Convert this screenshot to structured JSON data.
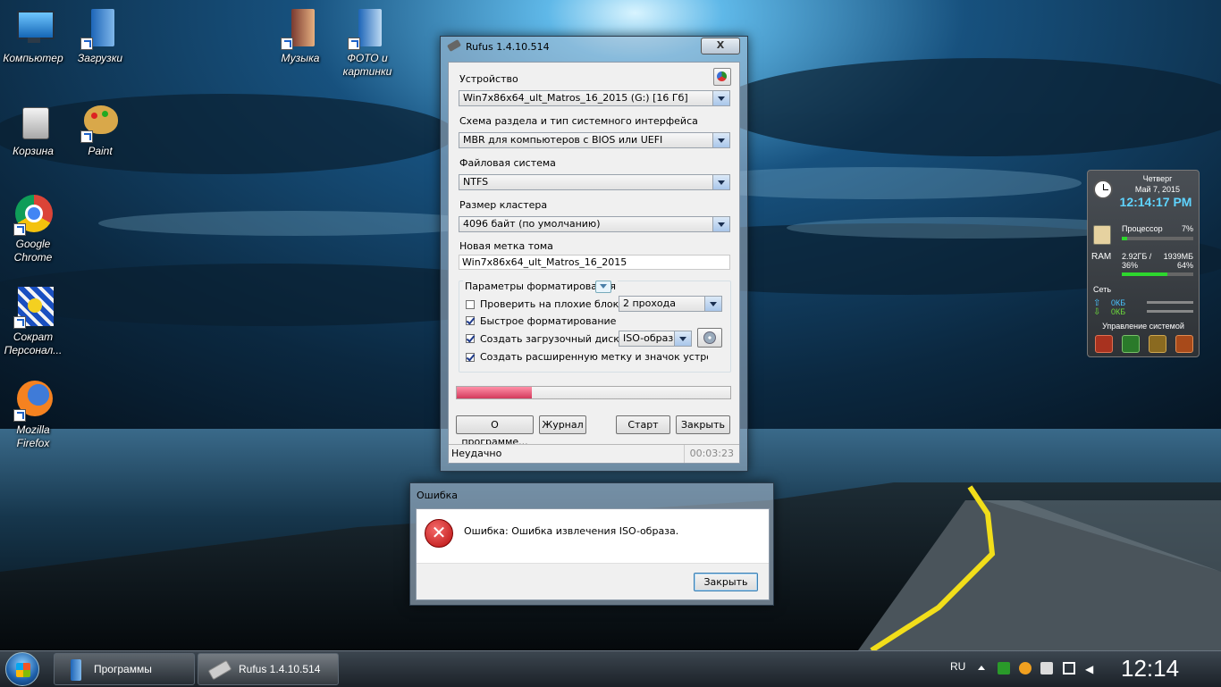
{
  "desktop": {
    "icons": [
      {
        "label": "Компьютер",
        "icon": "computer-icon"
      },
      {
        "label": "Загрузки",
        "icon": "downloads-folder-icon"
      },
      {
        "label": "Музыка",
        "icon": "music-folder-icon"
      },
      {
        "label": "ФОТО и картинки",
        "icon": "pictures-folder-icon"
      },
      {
        "label": "Корзина",
        "icon": "recycle-bin-icon"
      },
      {
        "label": "Paint",
        "icon": "paint-icon"
      },
      {
        "label": "Google Chrome",
        "icon": "chrome-icon"
      },
      {
        "label": "Сократ Персонал...",
        "icon": "socrat-icon"
      },
      {
        "label": "Mozilla Firefox",
        "icon": "firefox-icon"
      }
    ]
  },
  "rufus": {
    "title": "Rufus 1.4.10.514",
    "close": "X",
    "device_label": "Устройство",
    "device_value": "Win7x86x64_ult_Matros_16_2015 (G:) [16 Гб]",
    "partition_label": "Схема раздела и тип системного интерфейса",
    "partition_value": "MBR для компьютеров с BIOS или UEFI",
    "fs_label": "Файловая система",
    "fs_value": "NTFS",
    "cluster_label": "Размер кластера",
    "cluster_value": "4096 байт (по умолчанию)",
    "volume_label": "Новая метка тома",
    "volume_value": "Win7x86x64_ult_Matros_16_2015",
    "format_options": "Параметры форматирования",
    "check_bad": "Проверить на плохие блоки:",
    "passes": "2 прохода",
    "quick_format": "Быстрое форматирование",
    "bootable": "Создать загрузочный диск",
    "boot_type": "ISO-образ",
    "extended_label": "Создать расширенную метку и значок устройства",
    "progress_fraction": 0.275,
    "about_button": "О программе...",
    "log_button": "Журнал",
    "start_button": "Старт",
    "close_button": "Закрыть",
    "status": "Неудачно",
    "elapsed": "00:03:23"
  },
  "error_dialog": {
    "title": "Ошибка",
    "message": "Ошибка: Ошибка извлечения ISO-образа.",
    "close_button": "Закрыть"
  },
  "gadget": {
    "day": "Четверг",
    "date": "Май 7, 2015",
    "time": "12:14:17 PM",
    "cpu_label": "Процессор",
    "cpu_value": "7%",
    "cpu_fraction": 0.07,
    "ram_label": "RAM",
    "ram_used": "2.92ГБ /",
    "ram_free": "1939МБ",
    "ram_pct_a": "36%",
    "ram_pct_b": "64%",
    "ram_fraction": 0.64,
    "net_label": "Сеть",
    "up": "0КБ",
    "down": "0КБ",
    "system_label": "Управление системой"
  },
  "taskbar": {
    "programs": "Программы",
    "rufus": "Rufus 1.4.10.514",
    "lang": "RU",
    "clock": "12:14"
  }
}
